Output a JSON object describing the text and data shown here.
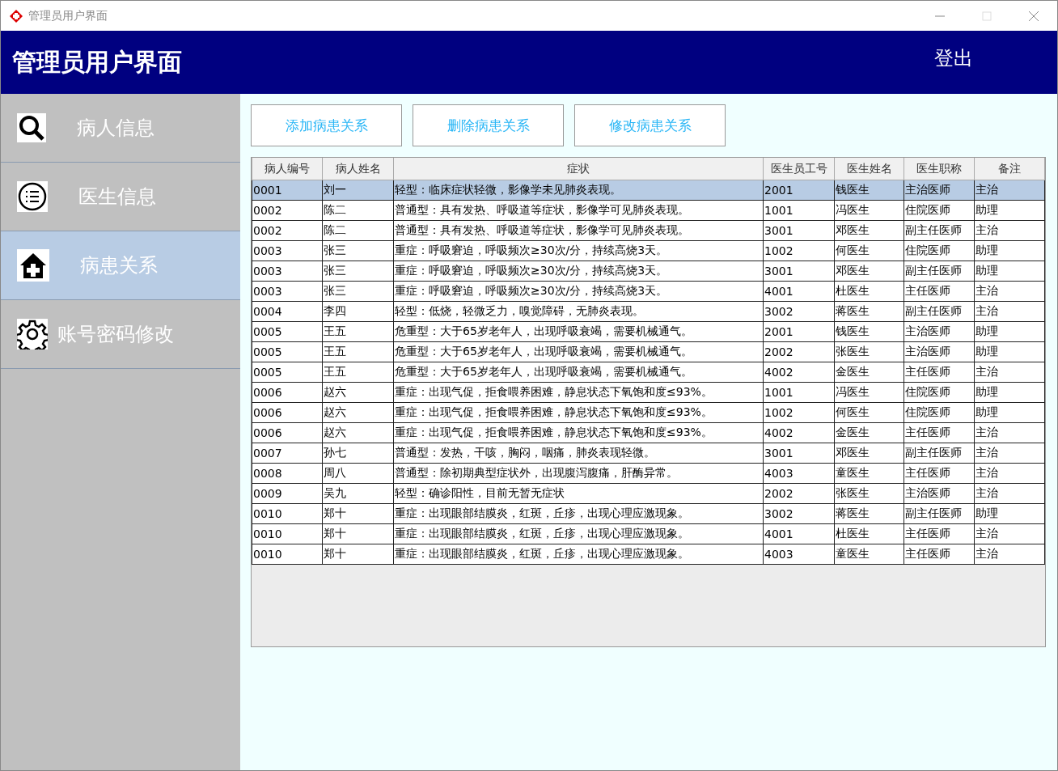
{
  "window": {
    "title": "管理员用户界面"
  },
  "header": {
    "title": "管理员用户界面",
    "logout": "登出"
  },
  "sidebar": {
    "items": [
      {
        "label": "病人信息",
        "selected": false
      },
      {
        "label": "医生信息",
        "selected": false
      },
      {
        "label": "病患关系",
        "selected": true
      },
      {
        "label": "账号密码修改",
        "selected": false
      }
    ]
  },
  "actions": [
    "添加病患关系",
    "删除病患关系",
    "修改病患关系"
  ],
  "table": {
    "columns": [
      "病人编号",
      "病人姓名",
      "症状",
      "医生员工号",
      "医生姓名",
      "医生职称",
      "备注"
    ],
    "rows": [
      {
        "cells": [
          "0001",
          "刘一",
          "轻型：临床症状轻微，影像学未见肺炎表现。",
          "2001",
          "钱医生",
          "主治医师",
          "主治"
        ],
        "selected": true
      },
      {
        "cells": [
          "0002",
          "陈二",
          "普通型：具有发热、呼吸道等症状，影像学可见肺炎表现。",
          "1001",
          "冯医生",
          "住院医师",
          "助理"
        ],
        "selected": false
      },
      {
        "cells": [
          "0002",
          "陈二",
          "普通型：具有发热、呼吸道等症状，影像学可见肺炎表现。",
          "3001",
          "邓医生",
          "副主任医师",
          "主治"
        ],
        "selected": false
      },
      {
        "cells": [
          "0003",
          "张三",
          "重症：呼吸窘迫，呼吸频次≥30次/分，持续高烧3天。",
          "1002",
          "何医生",
          "住院医师",
          "助理"
        ],
        "selected": false
      },
      {
        "cells": [
          "0003",
          "张三",
          "重症：呼吸窘迫，呼吸频次≥30次/分，持续高烧3天。",
          "3001",
          "邓医生",
          "副主任医师",
          "助理"
        ],
        "selected": false
      },
      {
        "cells": [
          "0003",
          "张三",
          "重症：呼吸窘迫，呼吸频次≥30次/分，持续高烧3天。",
          "4001",
          "杜医生",
          "主任医师",
          "主治"
        ],
        "selected": false
      },
      {
        "cells": [
          "0004",
          "李四",
          "轻型：低烧，轻微乏力，嗅觉障碍，无肺炎表现。",
          "3002",
          "蒋医生",
          "副主任医师",
          "主治"
        ],
        "selected": false
      },
      {
        "cells": [
          "0005",
          "王五",
          "危重型：大于65岁老年人，出现呼吸衰竭，需要机械通气。",
          "2001",
          "钱医生",
          "主治医师",
          "助理"
        ],
        "selected": false
      },
      {
        "cells": [
          "0005",
          "王五",
          "危重型：大于65岁老年人，出现呼吸衰竭，需要机械通气。",
          "2002",
          "张医生",
          "主治医师",
          "助理"
        ],
        "selected": false
      },
      {
        "cells": [
          "0005",
          "王五",
          "危重型：大于65岁老年人，出现呼吸衰竭，需要机械通气。",
          "4002",
          "金医生",
          "主任医师",
          "主治"
        ],
        "selected": false
      },
      {
        "cells": [
          "0006",
          "赵六",
          "重症：出现气促，拒食喂养困难，静息状态下氧饱和度≤93%。",
          "1001",
          "冯医生",
          "住院医师",
          "助理"
        ],
        "selected": false
      },
      {
        "cells": [
          "0006",
          "赵六",
          "重症：出现气促，拒食喂养困难，静息状态下氧饱和度≤93%。",
          "1002",
          "何医生",
          "住院医师",
          "助理"
        ],
        "selected": false
      },
      {
        "cells": [
          "0006",
          "赵六",
          "重症：出现气促，拒食喂养困难，静息状态下氧饱和度≤93%。",
          "4002",
          "金医生",
          "主任医师",
          "主治"
        ],
        "selected": false
      },
      {
        "cells": [
          "0007",
          "孙七",
          "普通型：发热，干咳，胸闷，咽痛，肺炎表现轻微。",
          "3001",
          "邓医生",
          "副主任医师",
          "主治"
        ],
        "selected": false
      },
      {
        "cells": [
          "0008",
          "周八",
          "普通型：除初期典型症状外，出现腹泻腹痛，肝酶异常。",
          "4003",
          "童医生",
          "主任医师",
          "主治"
        ],
        "selected": false
      },
      {
        "cells": [
          "0009",
          "吴九",
          "轻型：确诊阳性，目前无暂无症状",
          "2002",
          "张医生",
          "主治医师",
          "主治"
        ],
        "selected": false
      },
      {
        "cells": [
          "0010",
          "郑十",
          "重症：出现眼部结膜炎，红斑，丘疹，出现心理应激现象。",
          "3002",
          "蒋医生",
          "副主任医师",
          "助理"
        ],
        "selected": false
      },
      {
        "cells": [
          "0010",
          "郑十",
          "重症：出现眼部结膜炎，红斑，丘疹，出现心理应激现象。",
          "4001",
          "杜医生",
          "主任医师",
          "主治"
        ],
        "selected": false
      },
      {
        "cells": [
          "0010",
          "郑十",
          "重症：出现眼部结膜炎，红斑，丘疹，出现心理应激现象。",
          "4003",
          "童医生",
          "主任医师",
          "主治"
        ],
        "selected": false
      }
    ]
  }
}
